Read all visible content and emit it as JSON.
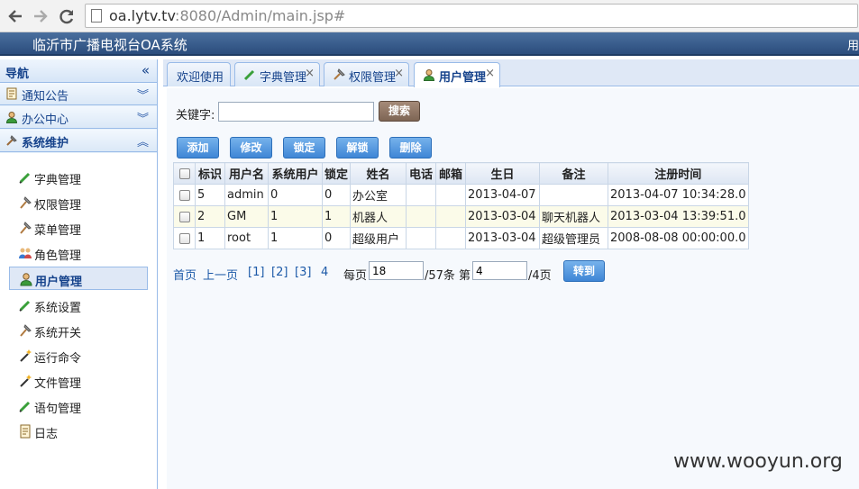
{
  "browser": {
    "url_host": "oa.lytv.tv",
    "url_rest": ":8080/Admin/main.jsp#"
  },
  "app": {
    "title": "临沂市广播电视台OA系统",
    "header_right": "用"
  },
  "sidebar": {
    "heading": "导航",
    "collapse_glyph": "«",
    "sections": [
      {
        "label": "通知公告",
        "icon": "notice-icon",
        "arrow": "︾"
      },
      {
        "label": "办公中心",
        "icon": "user-icon",
        "arrow": "︾"
      },
      {
        "label": "系统维护",
        "icon": "hammer-icon",
        "arrow": "︽"
      }
    ],
    "items": [
      {
        "label": "字典管理",
        "icon": "pencil-icon"
      },
      {
        "label": "权限管理",
        "icon": "hammer-icon"
      },
      {
        "label": "菜单管理",
        "icon": "hammer-icon"
      },
      {
        "label": "角色管理",
        "icon": "users-icon"
      },
      {
        "label": "用户管理",
        "icon": "user-icon"
      },
      {
        "label": "系统设置",
        "icon": "pencil-icon"
      },
      {
        "label": "系统开关",
        "icon": "hammer-icon"
      },
      {
        "label": "运行命令",
        "icon": "wand-icon"
      },
      {
        "label": "文件管理",
        "icon": "wand-icon"
      },
      {
        "label": "语句管理",
        "icon": "pencil-icon"
      },
      {
        "label": "日志",
        "icon": "notice-icon"
      }
    ],
    "selected": "用户管理"
  },
  "tabs": [
    {
      "label": "欢迎使用",
      "closable": false
    },
    {
      "label": "字典管理",
      "closable": true,
      "icon": "pencil-icon"
    },
    {
      "label": "权限管理",
      "closable": true,
      "icon": "hammer-icon"
    },
    {
      "label": "用户管理",
      "closable": true,
      "icon": "user-icon",
      "active": true
    }
  ],
  "search": {
    "label": "关键字:",
    "value": "",
    "button": "搜索"
  },
  "actions": [
    "添加",
    "修改",
    "锁定",
    "解锁",
    "删除"
  ],
  "table": {
    "columns": [
      "",
      "标识",
      "用户名",
      "系统用户",
      "锁定",
      "姓名",
      "电话",
      "邮箱",
      "生日",
      "备注",
      "注册时间"
    ],
    "rows": [
      [
        "",
        "5",
        "admin",
        "0",
        "0",
        "办公室",
        "",
        "",
        "2013-04-07",
        "",
        "2013-04-07 10:34:28.0"
      ],
      [
        "",
        "2",
        "GM",
        "1",
        "1",
        "机器人",
        "",
        "",
        "2013-03-04",
        "聊天机器人",
        "2013-03-04 13:39:51.0"
      ],
      [
        "",
        "1",
        "root",
        "1",
        "0",
        "超级用户",
        "",
        "",
        "2013-03-04",
        "超级管理员",
        "2008-08-08 00:00:00.0"
      ]
    ]
  },
  "pager": {
    "first": "首页",
    "prev": "上一页",
    "pages": [
      "[1]",
      "[2]",
      "[3]",
      "4"
    ],
    "per_page_label": "每页",
    "per_page_value": "18",
    "total_label": "/57条 第",
    "page_value": "4",
    "page_total": "/4页",
    "go_button": "转到"
  },
  "watermark": "www.wooyun.org",
  "colors": {
    "header": "#2b4d7d",
    "sidebar_bg": "#e8f1fb",
    "border": "#99bbe8",
    "action_button": "#3f86d6",
    "search_button": "#7e6554"
  }
}
